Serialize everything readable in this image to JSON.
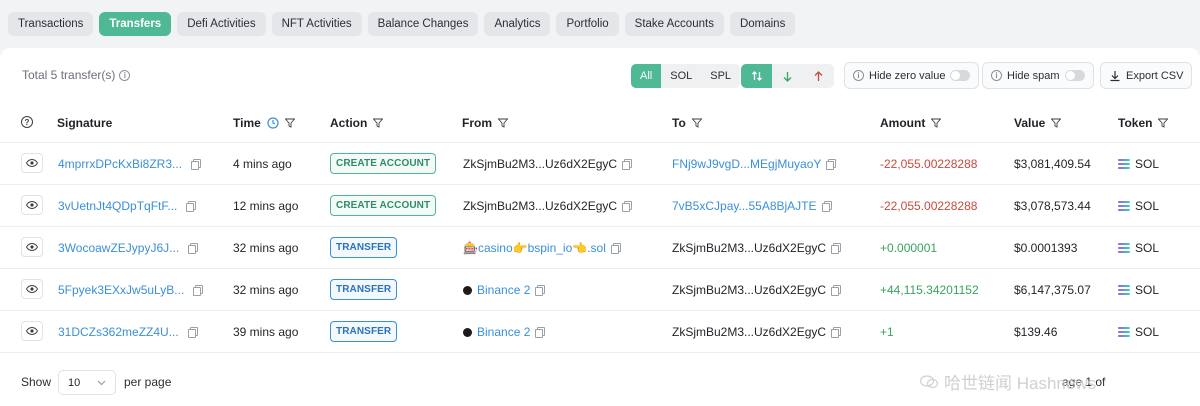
{
  "tabs": [
    {
      "label": "Transactions",
      "active": false
    },
    {
      "label": "Transfers",
      "active": true
    },
    {
      "label": "Defi Activities",
      "active": false
    },
    {
      "label": "NFT Activities",
      "active": false
    },
    {
      "label": "Balance Changes",
      "active": false
    },
    {
      "label": "Analytics",
      "active": false
    },
    {
      "label": "Portfolio",
      "active": false
    },
    {
      "label": "Stake Accounts",
      "active": false
    },
    {
      "label": "Domains",
      "active": false
    }
  ],
  "toolbar": {
    "total": "Total 5 transfer(s)",
    "filters": [
      "All",
      "SOL",
      "SPL"
    ],
    "hide_zero": "Hide zero value",
    "hide_spam": "Hide spam",
    "export": "Export CSV"
  },
  "columns": {
    "signature": "Signature",
    "time": "Time",
    "action": "Action",
    "from": "From",
    "to": "To",
    "amount": "Amount",
    "value": "Value",
    "token": "Token"
  },
  "rows": [
    {
      "signature": "4mprrxDPcKxBi8ZR3...",
      "time": "4 mins ago",
      "action": "CREATE ACCOUNT",
      "from": "ZkSjmBu2M3...Uz6dX2EgyC",
      "to": "FNj9wJ9vgD...MEgjMuyaoY",
      "amount": "-22,055.00228288",
      "value": "$3,081,409.54",
      "token": "SOL"
    },
    {
      "signature": "3vUetnJt4QDpTqFtF...",
      "time": "12 mins ago",
      "action": "CREATE ACCOUNT",
      "from": "ZkSjmBu2M3...Uz6dX2EgyC",
      "to": "7vB5xCJpay...55A8BjAJTE",
      "amount": "-22,055.00228288",
      "value": "$3,078,573.44",
      "token": "SOL"
    },
    {
      "signature": "3WocoawZEJypyJ6J...",
      "time": "32 mins ago",
      "action": "TRANSFER",
      "from": "🎰casino👉bspin_io👈.sol",
      "to": "ZkSjmBu2M3...Uz6dX2EgyC",
      "amount": "+0.000001",
      "value": "$0.0001393",
      "token": "SOL"
    },
    {
      "signature": "5Fpyek3EXxJw5uLyB...",
      "time": "32 mins ago",
      "action": "TRANSFER",
      "from": "Binance 2",
      "to": "ZkSjmBu2M3...Uz6dX2EgyC",
      "amount": "+44,115.34201152",
      "value": "$6,147,375.07",
      "token": "SOL"
    },
    {
      "signature": "31DCZs362meZZ4U...",
      "time": "39 mins ago",
      "action": "TRANSFER",
      "from": "Binance 2",
      "to": "ZkSjmBu2M3...Uz6dX2EgyC",
      "amount": "+1",
      "value": "$139.46",
      "token": "SOL"
    }
  ],
  "footer": {
    "show": "Show",
    "page_size": "10",
    "per_page": "per page",
    "watermark": "哈世链闻 Hashnews",
    "page_info": "age 1 of"
  },
  "colors": {
    "accent": "#4fb894",
    "link": "#3a8fd9",
    "negative": "#c74a3a",
    "positive": "#3aa25f"
  }
}
